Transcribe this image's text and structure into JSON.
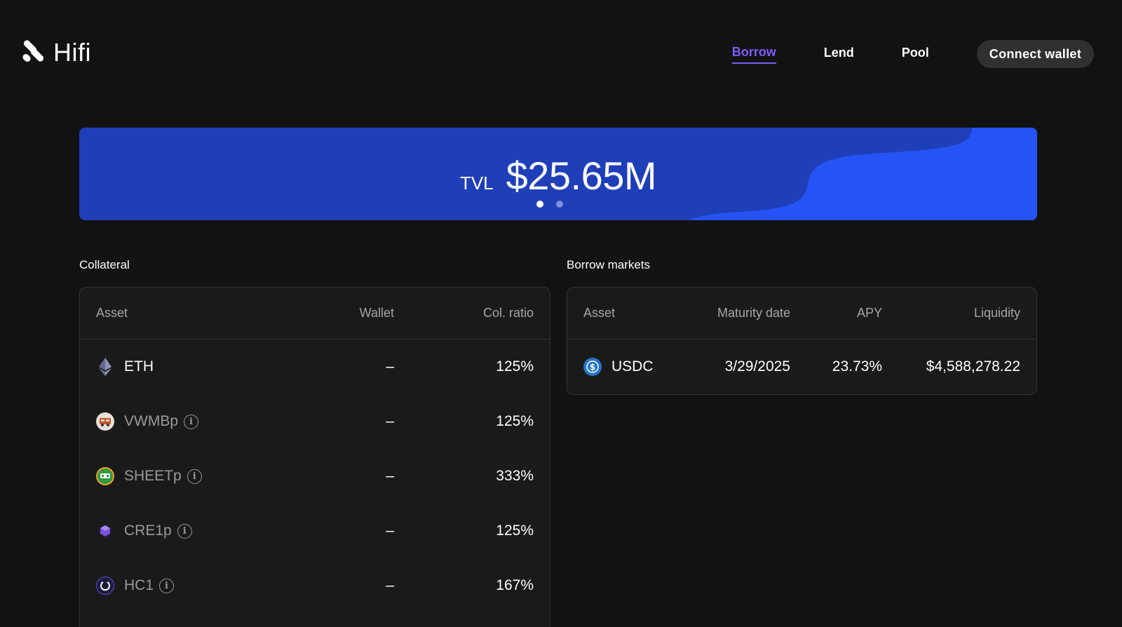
{
  "header": {
    "logo_text": "Hifi",
    "nav": [
      {
        "label": "Borrow",
        "active": true
      },
      {
        "label": "Lend",
        "active": false
      },
      {
        "label": "Pool",
        "active": false
      }
    ],
    "connect_label": "Connect wallet"
  },
  "banner": {
    "label": "TVL",
    "value": "$25.65M",
    "slides": 2,
    "active_slide": 1
  },
  "collateral": {
    "title": "Collateral",
    "columns": [
      "Asset",
      "Wallet",
      "Col. ratio"
    ],
    "rows": [
      {
        "asset": "ETH",
        "icon": "eth-icon",
        "info": false,
        "wallet": "–",
        "ratio": "125%"
      },
      {
        "asset": "VWMBp",
        "icon": "vwmbp-icon",
        "info": true,
        "wallet": "–",
        "ratio": "125%"
      },
      {
        "asset": "SHEETp",
        "icon": "sheetp-icon",
        "info": true,
        "wallet": "–",
        "ratio": "333%"
      },
      {
        "asset": "CRE1p",
        "icon": "cre1p-icon",
        "info": true,
        "wallet": "–",
        "ratio": "125%"
      },
      {
        "asset": "HC1",
        "icon": "hc1-icon",
        "info": true,
        "wallet": "–",
        "ratio": "167%"
      }
    ]
  },
  "borrow_markets": {
    "title": "Borrow markets",
    "columns": [
      "Asset",
      "Maturity date",
      "APY",
      "Liquidity"
    ],
    "rows": [
      {
        "asset": "USDC",
        "icon": "usdc-icon",
        "maturity": "3/29/2025",
        "apy": "23.73%",
        "liquidity": "$4,588,278.22"
      }
    ]
  },
  "colors": {
    "background": "#121212",
    "accent": "#7b5cf5",
    "banner": "#1f3fb8",
    "banner_wave": "#2553f5"
  }
}
